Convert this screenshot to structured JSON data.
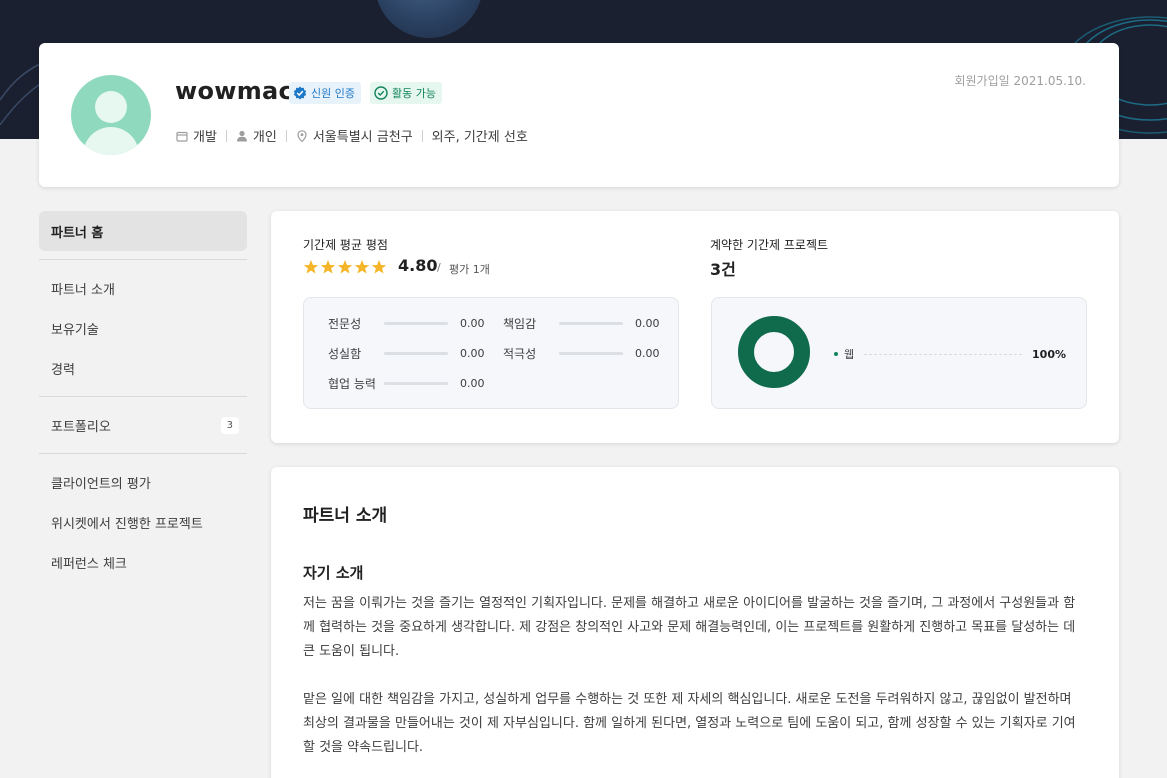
{
  "profile": {
    "username": "wowmac",
    "badges": [
      {
        "label": "신원 인증",
        "icon": "verified-icon"
      },
      {
        "label": "활동 가능",
        "icon": "check-circle-icon"
      }
    ],
    "meta": [
      {
        "icon": "briefcase-icon",
        "label": "개발"
      },
      {
        "icon": "person-icon",
        "label": "개인"
      },
      {
        "icon": "location-pin-icon",
        "label": "서울특별시 금천구"
      },
      {
        "icon": "",
        "label": "외주, 기간제 선호"
      }
    ],
    "joined": "회원가입일 2021.05.10."
  },
  "sidebar": {
    "items": [
      {
        "label": "파트너 홈",
        "active": true
      },
      {
        "label": "파트너 소개"
      },
      {
        "label": "보유기술"
      },
      {
        "label": "경력"
      },
      {
        "label": "포트폴리오",
        "count": "3"
      },
      {
        "label": "클라이언트의 평가"
      },
      {
        "label": "위시켓에서 진행한 프로젝트"
      },
      {
        "label": "레퍼런스 체크"
      }
    ]
  },
  "rating": {
    "title": "기간제 평균 평점",
    "stars": 5,
    "score": "4.80",
    "slash": "/",
    "count_label": "평가 1개",
    "metrics": [
      {
        "label": "전문성",
        "value": "0.00",
        "fraction": 0
      },
      {
        "label": "책임감",
        "value": "0.00",
        "fraction": 0
      },
      {
        "label": "성실함",
        "value": "0.00",
        "fraction": 0
      },
      {
        "label": "적극성",
        "value": "0.00",
        "fraction": 0
      },
      {
        "label": "협업 능력",
        "value": "0.00",
        "fraction": 0
      }
    ]
  },
  "projects": {
    "title": "계약한 기간제 프로젝트",
    "count": "3건",
    "legend": [
      {
        "label": "웹",
        "percent": "100%",
        "fraction": 1.0
      }
    ]
  },
  "colors": {
    "accent": "#12845c",
    "donut": "#0f6b4c",
    "star": "#f5b52a",
    "verify": "#1e78c8"
  },
  "intro": {
    "title": "파트너 소개",
    "subtitle": "자기 소개",
    "paragraphs": [
      "저는 꿈을 이뤄가는 것을 즐기는 열정적인 기획자입니다. 문제를 해결하고 새로운 아이디어를 발굴하는 것을 즐기며, 그 과정에서 구성원들과 함께 협력하는 것을 중요하게 생각합니다. 제 강점은 창의적인 사고와 문제 해결능력인데, 이는 프로젝트를 원활하게 진행하고 목표를 달성하는 데 큰 도움이 됩니다.",
      "맡은 일에 대한 책임감을 가지고, 성실하게 업무를 수행하는 것 또한 제 자세의 핵심입니다. 새로운 도전을 두려워하지 않고, 끊임없이 발전하며 최상의 결과물을 만들어내는 것이 제 자부심입니다. 함께 일하게 된다면, 열정과 노력으로 팀에 도움이 되고, 함께 성장할 수 있는 기획자로 기여할 것을 약속드립니다."
    ]
  }
}
